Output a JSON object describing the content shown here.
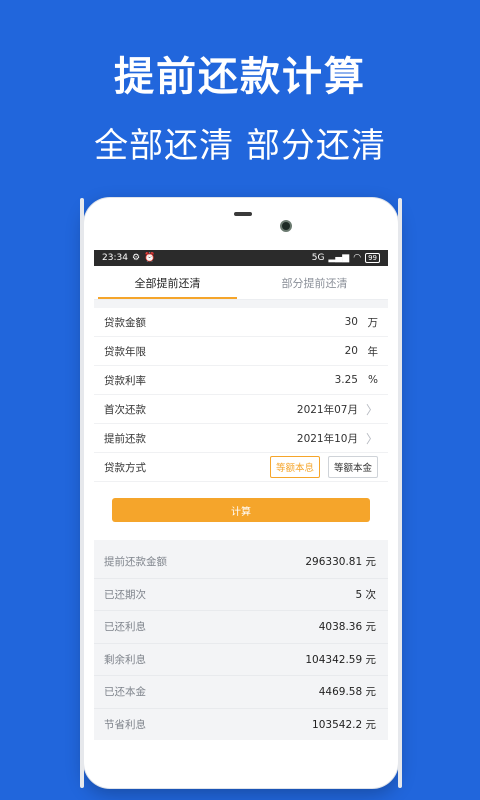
{
  "banner": {
    "headline": "提前还款计算",
    "subline": "全部还清  部分还清"
  },
  "statusbar": {
    "time": "23:34",
    "icons_left": [
      "settings-icon",
      "alarm-icon"
    ],
    "signal": "5G",
    "battery": "99"
  },
  "tabs": [
    {
      "label": "全部提前还清",
      "active": true
    },
    {
      "label": "部分提前还清",
      "active": false
    }
  ],
  "form": {
    "loan_amount": {
      "label": "贷款金额",
      "value": "30",
      "unit": "万"
    },
    "loan_years": {
      "label": "贷款年限",
      "value": "20",
      "unit": "年"
    },
    "loan_rate": {
      "label": "贷款利率",
      "value": "3.25",
      "unit": "%"
    },
    "first_payment": {
      "label": "首次还款",
      "value": "2021年07月"
    },
    "early_payment": {
      "label": "提前还款",
      "value": "2021年10月"
    },
    "method": {
      "label": "贷款方式",
      "options": [
        "等额本息",
        "等额本金"
      ],
      "selected": "等额本息"
    }
  },
  "calc_button": "计算",
  "results": [
    {
      "label": "提前还款金额",
      "value": "296330.81 元"
    },
    {
      "label": "已还期次",
      "value": "5 次"
    },
    {
      "label": "已还利息",
      "value": "4038.36 元"
    },
    {
      "label": "剩余利息",
      "value": "104342.59 元"
    },
    {
      "label": "已还本金",
      "value": "4469.58 元"
    },
    {
      "label": "节省利息",
      "value": "103542.2 元"
    }
  ],
  "colors": {
    "background": "#2166dc",
    "accent": "#f5a52b"
  }
}
